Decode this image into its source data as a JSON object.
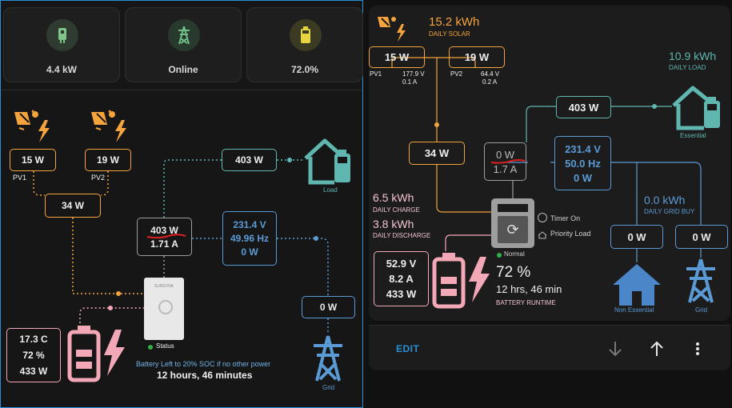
{
  "tiles": [
    {
      "value": "4.4 kW",
      "icon": "inverter-icon",
      "bg": "#2f3b30",
      "fg": "#7fc58a"
    },
    {
      "value": "Online",
      "icon": "transmission-tower-icon",
      "bg": "#283a2d",
      "fg": "#6fbf86"
    },
    {
      "value": "72.0%",
      "icon": "battery-icon",
      "bg": "#3b3a22",
      "fg": "#e6d442"
    }
  ],
  "left_card": {
    "pv1_power": "15 W",
    "pv1_label": "PV1",
    "pv2_power": "19 W",
    "pv2_label": "PV2",
    "pv_total": "34 W",
    "load_power": "403 W",
    "load_label": "Load",
    "inverter_power": "403 W",
    "inverter_current": "1.71 A",
    "grid_voltage": "231.4 V",
    "grid_freq": "49.96 Hz",
    "grid_power_inner": "0 W",
    "grid_power": "0 W",
    "grid_label": "Grid",
    "battery_temp": "17.3 C",
    "battery_soc": "72 %",
    "battery_power": "433 W",
    "status_label": "Status",
    "battery_left_text": "Battery Left to 20% SOC if no other power",
    "battery_runtime": "12 hours, 46 minutes",
    "inverter_brand": "SUNSYNK"
  },
  "right_card": {
    "daily_solar_value": "15.2 kWh",
    "daily_solar_label": "DAILY SOLAR",
    "pv1_power": "15 W",
    "pv1_label": "PV1",
    "pv1_voltage": "177.9 V",
    "pv1_current": "0.1 A",
    "pv2_power": "19 W",
    "pv2_label": "PV2",
    "pv2_voltage": "64.4 V",
    "pv2_current": "0.2 A",
    "pv_total": "34 W",
    "daily_load_value": "10.9 kWh",
    "daily_load_label": "DAILY LOAD",
    "load_power": "403 W",
    "essential_label": "Essential",
    "inverter_power": "0 W",
    "inverter_current": "1.7 A",
    "grid_voltage": "231.4 V",
    "grid_freq": "50.0 Hz",
    "grid_power_inner": "0 W",
    "daily_charge_value": "6.5 kWh",
    "daily_charge_label": "DAILY CHARGE",
    "daily_discharge_value": "3.8 kWh",
    "daily_discharge_label": "DAILY DISCHARGE",
    "timer_label": "Timer On",
    "priority_label": "Priority Load",
    "daily_grid_buy_value": "0.0 kWh",
    "daily_grid_buy_label": "DAILY GRID BUY",
    "non_essential_power": "0 W",
    "non_essential_label": "Non Essential",
    "grid_power": "0 W",
    "grid_label": "Grid",
    "battery_voltage": "52.9 V",
    "battery_current": "8.2 A",
    "battery_power": "433 W",
    "normal_label": "Normal",
    "battery_soc": "72 %",
    "runtime": "12 hrs, 46 min",
    "runtime_label": "BATTERY RUNTIME"
  },
  "bottom_bar": {
    "edit_label": "EDIT",
    "down_icon": "arrow-down-icon",
    "up_icon": "arrow-up-icon",
    "menu_icon": "more-vert-icon"
  },
  "colors": {
    "solar": "#f5a33c",
    "load": "#5fb7b0",
    "grid": "#5b9bd5",
    "battery": "#f3a8b8",
    "inverter": "#9e9e9e",
    "accent": "#2b8fd6"
  }
}
